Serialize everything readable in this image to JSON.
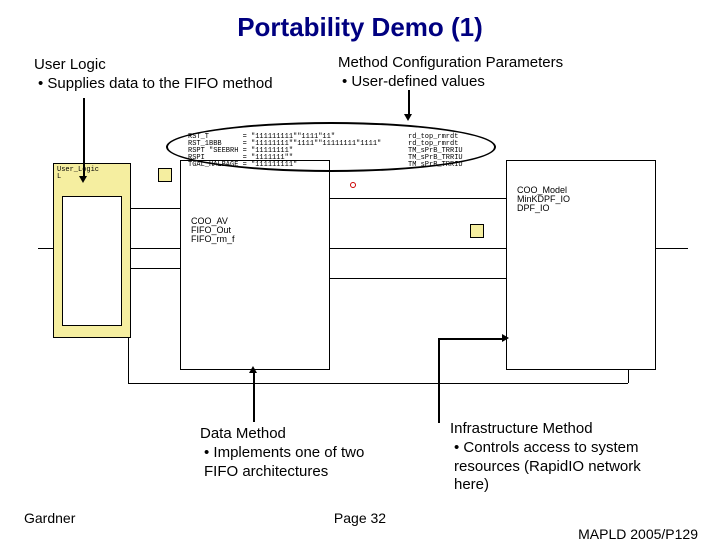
{
  "title": "Portability Demo (1)",
  "annotations": {
    "user_logic": {
      "heading": "User Logic",
      "bullet": "• Supplies data to the FIFO method"
    },
    "method_config": {
      "heading": "Method Configuration Parameters",
      "bullet": "• User-defined values"
    },
    "data_method": {
      "heading": "Data Method",
      "bullet1": "• Implements one of two",
      "bullet2": "  FIFO architectures"
    },
    "infra_method": {
      "heading": "Infrastructure Method",
      "bullet1": "• Controls access to system",
      "bullet2": "  resources (RapidIO network",
      "bullet3": "  here)"
    }
  },
  "blocks": {
    "user_logic_box": "User_Logic\nL",
    "coo_model_box": "COO_Model\nMinKDPF_IO\nDPF_IO",
    "center_labels": "COO_AV\nFIFO_Out\nFIFO_rm_f",
    "params_left": "RST_T        = \"111111111\"\"1111\"11\"\nRST_1BBB     = \"11111111\"\"1111\"\"11111111\"1111\"\nRSPT \"SEEBRH = \"11111111\"\nRSPI         = \"1111111\"\"\nTGAL_HALBAGE = \"111111111\"",
    "params_right": "rd_top_rmrdt\nrd_top_rmrdt\nTM_sPrB_TRRIU\nTM_sPrB_TRRIU\nTM_sPrB_TRRIU"
  },
  "footer": {
    "author": "Gardner",
    "page": "Page 32",
    "conf": "MAPLD 2005/P129"
  }
}
